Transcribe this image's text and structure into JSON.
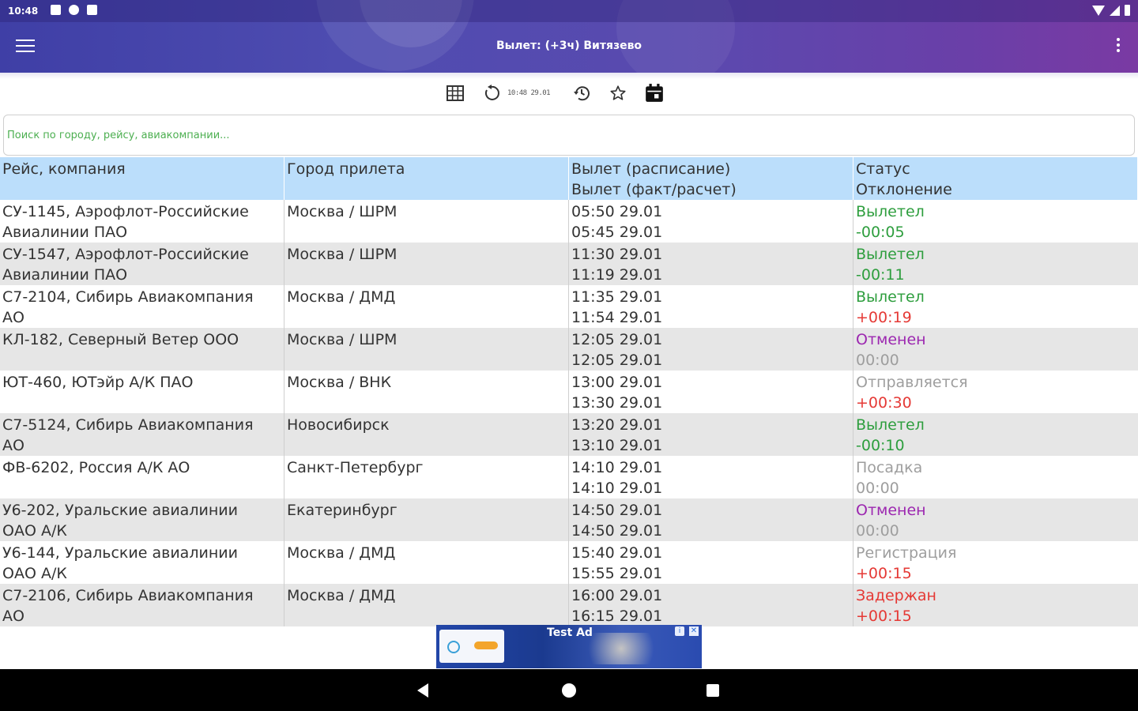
{
  "status_bar": {
    "time": "10:48"
  },
  "app_bar": {
    "title": "Вылет: (+3ч) Витязево"
  },
  "toolbar": {
    "updated_time": "10:48 29.01"
  },
  "search": {
    "placeholder": "Поиск по городу, рейсу, авиакомпании..."
  },
  "table": {
    "headers": [
      {
        "line1": "Рейс, компания",
        "line2": ""
      },
      {
        "line1": "Город прилета",
        "line2": ""
      },
      {
        "line1": "Вылет (расписание)",
        "line2": "Вылет (факт/расчет)"
      },
      {
        "line1": "Статус",
        "line2": "Отклонение"
      }
    ],
    "rows": [
      {
        "flight1": "СУ-1145, Аэрофлот-Российские",
        "flight2": "Авиалинии ПАО",
        "city": "Москва / ШРМ",
        "sched": "05:50 29.01",
        "actual": "05:45 29.01",
        "status": "Вылетел",
        "status_color": "#2e9e3e",
        "deviation": "-00:05",
        "deviation_color": "#2e9e3e"
      },
      {
        "flight1": "СУ-1547, Аэрофлот-Российские",
        "flight2": "Авиалинии ПАО",
        "city": "Москва / ШРМ",
        "sched": "11:30 29.01",
        "actual": "11:19 29.01",
        "status": "Вылетел",
        "status_color": "#2e9e3e",
        "deviation": "-00:11",
        "deviation_color": "#2e9e3e"
      },
      {
        "flight1": "С7-2104, Сибирь Авиакомпания",
        "flight2": "АО",
        "city": "Москва / ДМД",
        "sched": "11:35 29.01",
        "actual": "11:54 29.01",
        "status": "Вылетел",
        "status_color": "#2e9e3e",
        "deviation": "+00:19",
        "deviation_color": "#e53935"
      },
      {
        "flight1": "КЛ-182, Северный Ветер ООО",
        "flight2": "",
        "city": "Москва / ШРМ",
        "sched": "12:05 29.01",
        "actual": "12:05 29.01",
        "status": "Отменен",
        "status_color": "#9c27b0",
        "deviation": "00:00",
        "deviation_color": "#9e9e9e"
      },
      {
        "flight1": "ЮТ-460, ЮТэйр А/К ПАО",
        "flight2": "",
        "city": "Москва / ВНК",
        "sched": "13:00 29.01",
        "actual": "13:30 29.01",
        "status": "Отправляется",
        "status_color": "#9e9e9e",
        "deviation": "+00:30",
        "deviation_color": "#e53935"
      },
      {
        "flight1": "С7-5124, Сибирь Авиакомпания",
        "flight2": "АО",
        "city": "Новосибирск",
        "sched": "13:20 29.01",
        "actual": "13:10 29.01",
        "status": "Вылетел",
        "status_color": "#2e9e3e",
        "deviation": "-00:10",
        "deviation_color": "#2e9e3e"
      },
      {
        "flight1": "ФВ-6202, Россия А/К АО",
        "flight2": "",
        "city": "Санкт-Петербург",
        "sched": "14:10 29.01",
        "actual": "14:10 29.01",
        "status": "Посадка",
        "status_color": "#9e9e9e",
        "deviation": "00:00",
        "deviation_color": "#9e9e9e"
      },
      {
        "flight1": "У6-202, Уральские авиалинии",
        "flight2": "ОАО А/К",
        "city": "Екатеринбург",
        "sched": "14:50 29.01",
        "actual": "14:50 29.01",
        "status": "Отменен",
        "status_color": "#9c27b0",
        "deviation": "00:00",
        "deviation_color": "#9e9e9e"
      },
      {
        "flight1": "У6-144, Уральские авиалинии",
        "flight2": "ОАО А/К",
        "city": "Москва / ДМД",
        "sched": "15:40 29.01",
        "actual": "15:55 29.01",
        "status": "Регистрация",
        "status_color": "#9e9e9e",
        "deviation": "+00:15",
        "deviation_color": "#e53935"
      },
      {
        "flight1": "С7-2106, Сибирь Авиакомпания",
        "flight2": "АО",
        "city": "Москва / ДМД",
        "sched": "16:00 29.01",
        "actual": "16:15 29.01",
        "status": "Задержан",
        "status_color": "#e53935",
        "deviation": "+00:15",
        "deviation_color": "#e53935"
      }
    ]
  },
  "ad": {
    "label": "Test Ad"
  },
  "icons": {
    "menu": "hamburger-menu-icon",
    "more": "more-vert-icon",
    "grid": "grid-table-icon",
    "refresh": "refresh-icon",
    "history": "history-icon",
    "favorite": "star-icon",
    "calendar": "calendar-icon"
  }
}
